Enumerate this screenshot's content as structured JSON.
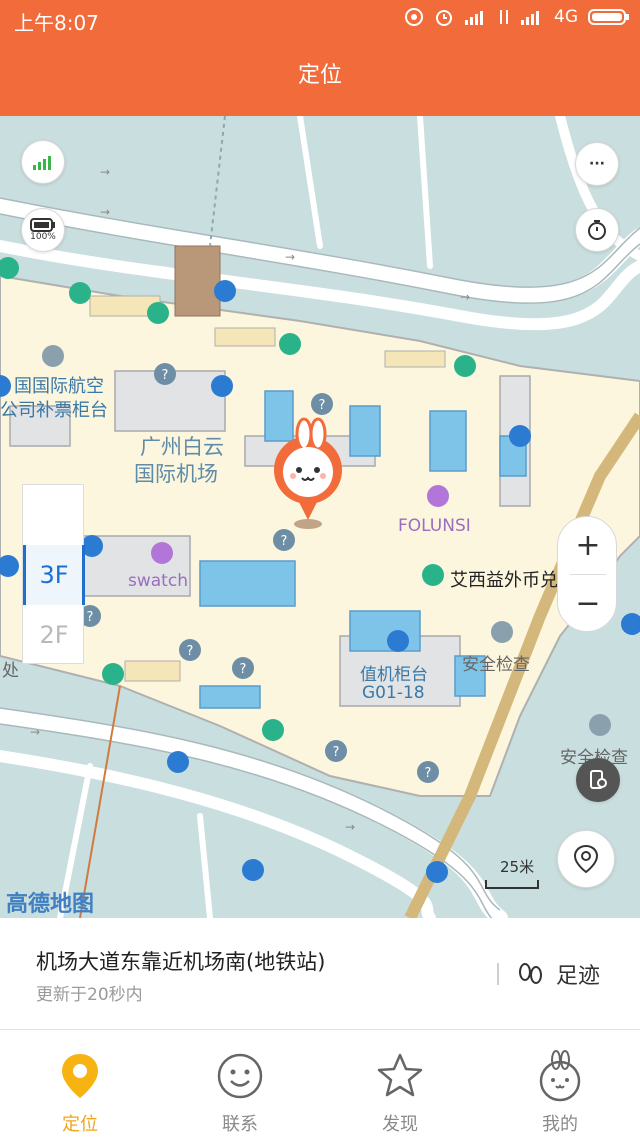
{
  "status_bar": {
    "time": "上午8:07",
    "network": "4G"
  },
  "header": {
    "title": "定位"
  },
  "map": {
    "labels": {
      "intl_ticket_1": "国国际航空",
      "intl_ticket_2": "公司补票柜台",
      "airport_1": "广州白云",
      "airport_2": "国际机场",
      "folunsi": "FOLUNSI",
      "swatch": "swatch",
      "exchange": "艾西益外币兑换",
      "checkin_1": "值机柜台",
      "checkin_2": "G01-18",
      "security_1": "安全检查",
      "security_2": "安全检查",
      "left_edge": "处",
      "scale": "25米",
      "logo": "高德地图",
      "battery": "100%"
    },
    "floors": [
      {
        "label": "3F",
        "active": true
      },
      {
        "label": "2F",
        "active": false
      }
    ],
    "zoom": {
      "in": "+",
      "out": "−"
    },
    "more_button": "···",
    "colors": {
      "brand": "#f26b3a",
      "floor_active": "#1d6fd0",
      "map_bg": "#c9dede"
    }
  },
  "location_card": {
    "address": "机场大道东靠近机场南(地铁站)",
    "updated": "更新于20秒内",
    "trail_label": "足迹"
  },
  "tabs": [
    {
      "label": "定位",
      "icon": "location-pin-icon",
      "active": true
    },
    {
      "label": "联系",
      "icon": "smiley-icon",
      "active": false
    },
    {
      "label": "发现",
      "icon": "star-icon",
      "active": false
    },
    {
      "label": "我的",
      "icon": "rabbit-face-icon",
      "active": false
    }
  ]
}
